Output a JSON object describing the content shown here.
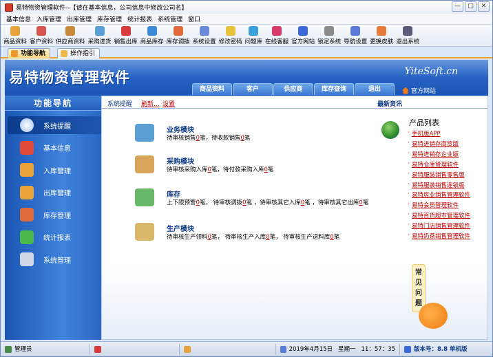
{
  "window": {
    "title": "易特物资管理软件--【请在基本信息，公司信息中修改公司名】",
    "controls": {
      "minimize": "—",
      "maximize": "□",
      "close": "✕"
    }
  },
  "menu": [
    "基本信息",
    "入库管理",
    "出库管理",
    "库存管理",
    "统计报表",
    "系统管理",
    "窗口"
  ],
  "toolbar": [
    {
      "label": "商品资料",
      "color": "#e8a23a"
    },
    {
      "label": "客户资料",
      "color": "#d9534f"
    },
    {
      "label": "供应商资料",
      "color": "#c98a3a"
    },
    {
      "label": "采购进货",
      "color": "#5a9fd4"
    },
    {
      "label": "销售出库",
      "color": "#d93a3a"
    },
    {
      "label": "商品库存",
      "color": "#3a8ad9"
    },
    {
      "label": "库存调拨",
      "color": "#e06a3a"
    },
    {
      "label": "系统设置",
      "color": "#6a8ad9"
    },
    {
      "label": "修改密码",
      "color": "#e8c23a"
    },
    {
      "label": "问题库",
      "color": "#3aa0d9"
    },
    {
      "label": "在线客服",
      "color": "#d93a6a"
    },
    {
      "label": "官方网站",
      "color": "#3a6ad9"
    },
    {
      "label": "锁定系统",
      "color": "#8a8a8a"
    },
    {
      "label": "导航设置",
      "color": "#5a7ad9"
    },
    {
      "label": "更换皮肤",
      "color": "#e87a3a"
    },
    {
      "label": "退出系统",
      "color": "#5a5a7a"
    }
  ],
  "tabs": [
    "功能导航",
    "操作指引"
  ],
  "banner": {
    "name": "易特物资管理软件",
    "site": "YiteSoft.cn",
    "nav": [
      "商品资料",
      "客户",
      "供应商",
      "库存查询",
      "退出"
    ],
    "official": "官方网站"
  },
  "sidebar": {
    "title": "功能导航",
    "items": [
      {
        "label": "系统提醒",
        "color": "#ffffff"
      },
      {
        "label": "基本信息",
        "color": "#e04a3a"
      },
      {
        "label": "入库管理",
        "color": "#e8a23a"
      },
      {
        "label": "出库管理",
        "color": "#e8a23a"
      },
      {
        "label": "库存管理",
        "color": "#e06a3a"
      },
      {
        "label": "统计报表",
        "color": "#4ab84a"
      },
      {
        "label": "系统管理",
        "color": "#d0d8e6"
      }
    ]
  },
  "main": {
    "tip": "系统提醒",
    "refresh": "刷新...",
    "settings": "设置",
    "news": "最新资讯",
    "modules": [
      {
        "title": "业务模块",
        "desc": [
          "待审核销售",
          "0",
          "笔，待收款销售",
          "0",
          "笔"
        ],
        "color": "#5a9fd4"
      },
      {
        "title": "采购模块",
        "desc": [
          "待审核采购入库",
          "0",
          "笔，待付款采购入库",
          "0",
          "笔"
        ],
        "color": "#d9a55a"
      },
      {
        "title": "库存",
        "desc": [
          "上下限预警",
          "0",
          "笔，  待审核调拨",
          "0",
          "笔  ，待审核其它入库",
          "0",
          "笔  ，待审核其它出库",
          "0",
          "笔"
        ],
        "color": "#6ab86a"
      },
      {
        "title": "生产模块",
        "desc": [
          "待审核生产领料",
          "0",
          "笔，  待审核生产入库",
          "0",
          "笔，  待审核生产退料库",
          "0",
          "笔"
        ],
        "color": "#d9b86a"
      }
    ],
    "products": {
      "title": "产品列表",
      "items": [
        "手机版APP",
        "易特进销存商贸版",
        "易特进销存企业版",
        "易特仓库管理软件",
        "易特服装销售零售版",
        "易特服装销售连锁版",
        "易特房业销售管理软件",
        "易特会员管理软件",
        "易特百货超市管理软件",
        "易特门店销售管理软件",
        "易特奶茶销售管理软件"
      ]
    },
    "faq": "常见问题"
  },
  "status": {
    "user": "管理员",
    "date": "2019年4月15日",
    "weekday": "星期一",
    "time": "11：57：35",
    "version": "版本号：8.8 单机版"
  }
}
